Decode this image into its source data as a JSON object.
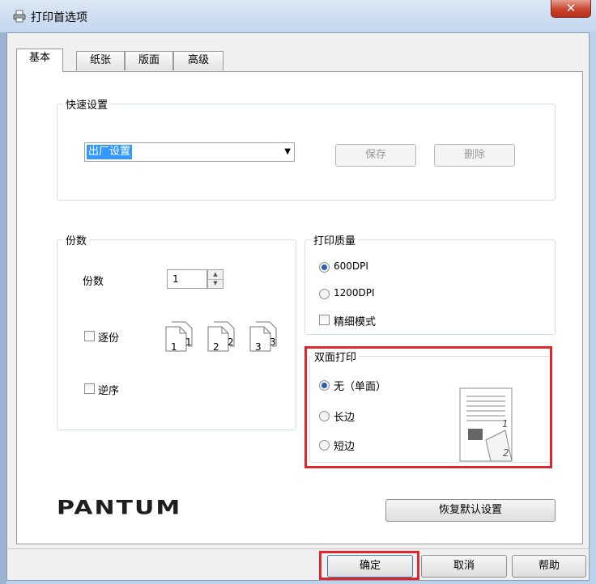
{
  "window": {
    "title": "打印首选项",
    "close_glyph": "✕"
  },
  "tabs": [
    {
      "label": "基本",
      "active": true
    },
    {
      "label": "纸张",
      "active": false
    },
    {
      "label": "版面",
      "active": false
    },
    {
      "label": "高级",
      "active": false
    }
  ],
  "quick_settings": {
    "title": "快速设置",
    "selected": "出厂设置",
    "save_label": "保存",
    "delete_label": "删除"
  },
  "copies": {
    "title": "份数",
    "label": "份数",
    "value": "1",
    "collate_label": "逐份",
    "collate_checked": false,
    "collate_pages": [
      "1",
      "2",
      "3"
    ],
    "reverse_label": "逆序",
    "reverse_checked": false
  },
  "quality": {
    "title": "打印质量",
    "options": [
      "600DPI",
      "1200DPI"
    ],
    "selected": "600DPI",
    "fine_mode_label": "精细模式",
    "fine_mode_checked": false
  },
  "duplex": {
    "title": "双面打印",
    "options": [
      "无（单面）",
      "长边",
      "短边"
    ],
    "selected": "无（单面）",
    "preview_pages": [
      "1",
      "2"
    ]
  },
  "brand": {
    "logo_text": "PANTUM"
  },
  "restore_label": "恢复默认设置",
  "footer": {
    "ok_label": "确定",
    "cancel_label": "取消",
    "help_label": "帮助"
  },
  "colors": {
    "highlight": "#e0262c",
    "selection": "#3399ff",
    "close_button": "#c7442e"
  }
}
